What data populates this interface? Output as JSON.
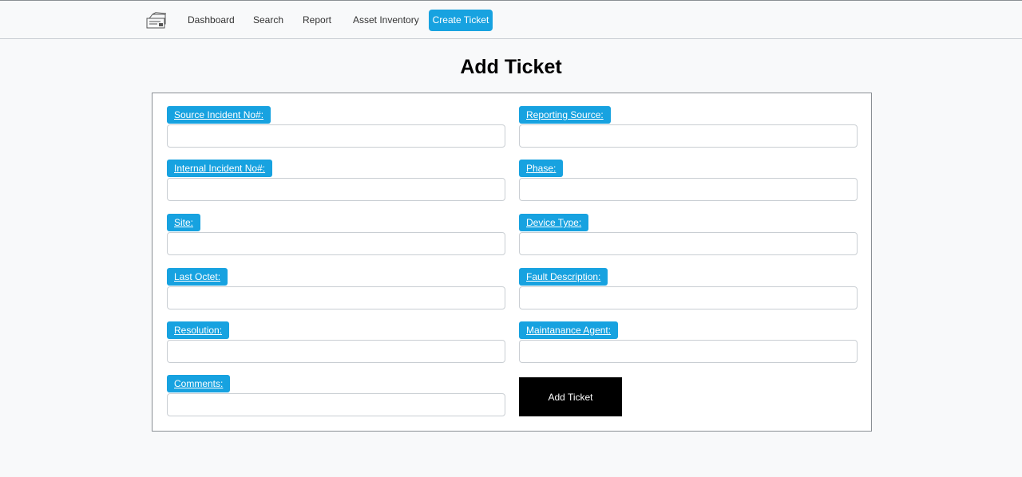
{
  "nav": {
    "logo": "ticket-logo-icon",
    "links": [
      "Dashboard",
      "Search",
      "Report",
      "Asset Inventory"
    ],
    "create_ticket": "Create Ticket"
  },
  "page": {
    "title": "Add Ticket"
  },
  "form": {
    "fields": [
      {
        "label": "Source Incident No#:",
        "value": "",
        "placeholder": ""
      },
      {
        "label": "Reporting Source:",
        "value": "",
        "placeholder": ""
      },
      {
        "label": "Internal Incident No#:",
        "value": "",
        "placeholder": ""
      },
      {
        "label": "Phase:",
        "value": "",
        "placeholder": ""
      },
      {
        "label": "Site:",
        "value": "",
        "placeholder": ""
      },
      {
        "label": "Device Type:",
        "value": "",
        "placeholder": ""
      },
      {
        "label": "Last Octet:",
        "value": "",
        "placeholder": ""
      },
      {
        "label": "Fault Description:",
        "value": "",
        "placeholder": ""
      },
      {
        "label": "Resolution:",
        "value": "",
        "placeholder": ""
      },
      {
        "label": "Maintanance Agent:",
        "value": "",
        "placeholder": ""
      },
      {
        "label": "Comments:",
        "value": "",
        "placeholder": ""
      }
    ],
    "submit_label": "Add Ticket"
  },
  "colors": {
    "accent": "#17a2e0",
    "submit_bg": "#000000",
    "page_bg": "#f8f9fa"
  }
}
